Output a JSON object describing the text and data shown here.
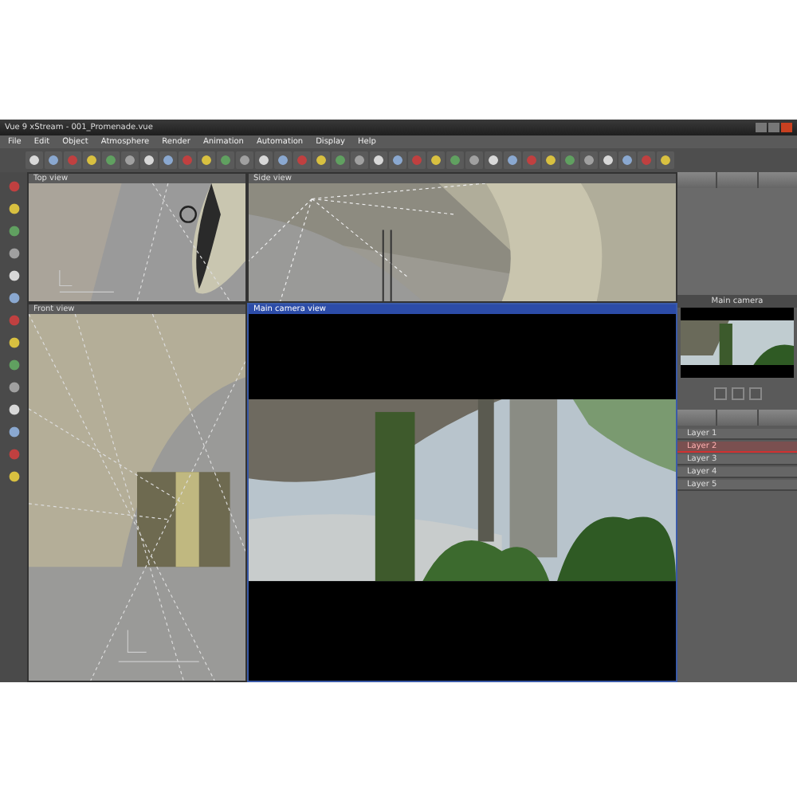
{
  "window": {
    "title": "Vue 9 xStream - 001_Promenade.vue"
  },
  "menu": [
    "File",
    "Edit",
    "Object",
    "Atmosphere",
    "Render",
    "Animation",
    "Automation",
    "Display",
    "Help"
  ],
  "viewports": [
    {
      "title": "Top view",
      "selected": false
    },
    {
      "title": "Side view",
      "selected": false
    },
    {
      "title": "Front view",
      "selected": false
    },
    {
      "title": "Main camera view",
      "selected": true
    }
  ],
  "camera_panel": {
    "title": "Main camera"
  },
  "layers": [
    {
      "name": "Layer 1",
      "selected": false
    },
    {
      "name": "Layer 2",
      "selected": true
    },
    {
      "name": "Layer 3",
      "selected": false
    },
    {
      "name": "Layer 4",
      "selected": false
    },
    {
      "name": "Layer 5",
      "selected": false
    }
  ]
}
